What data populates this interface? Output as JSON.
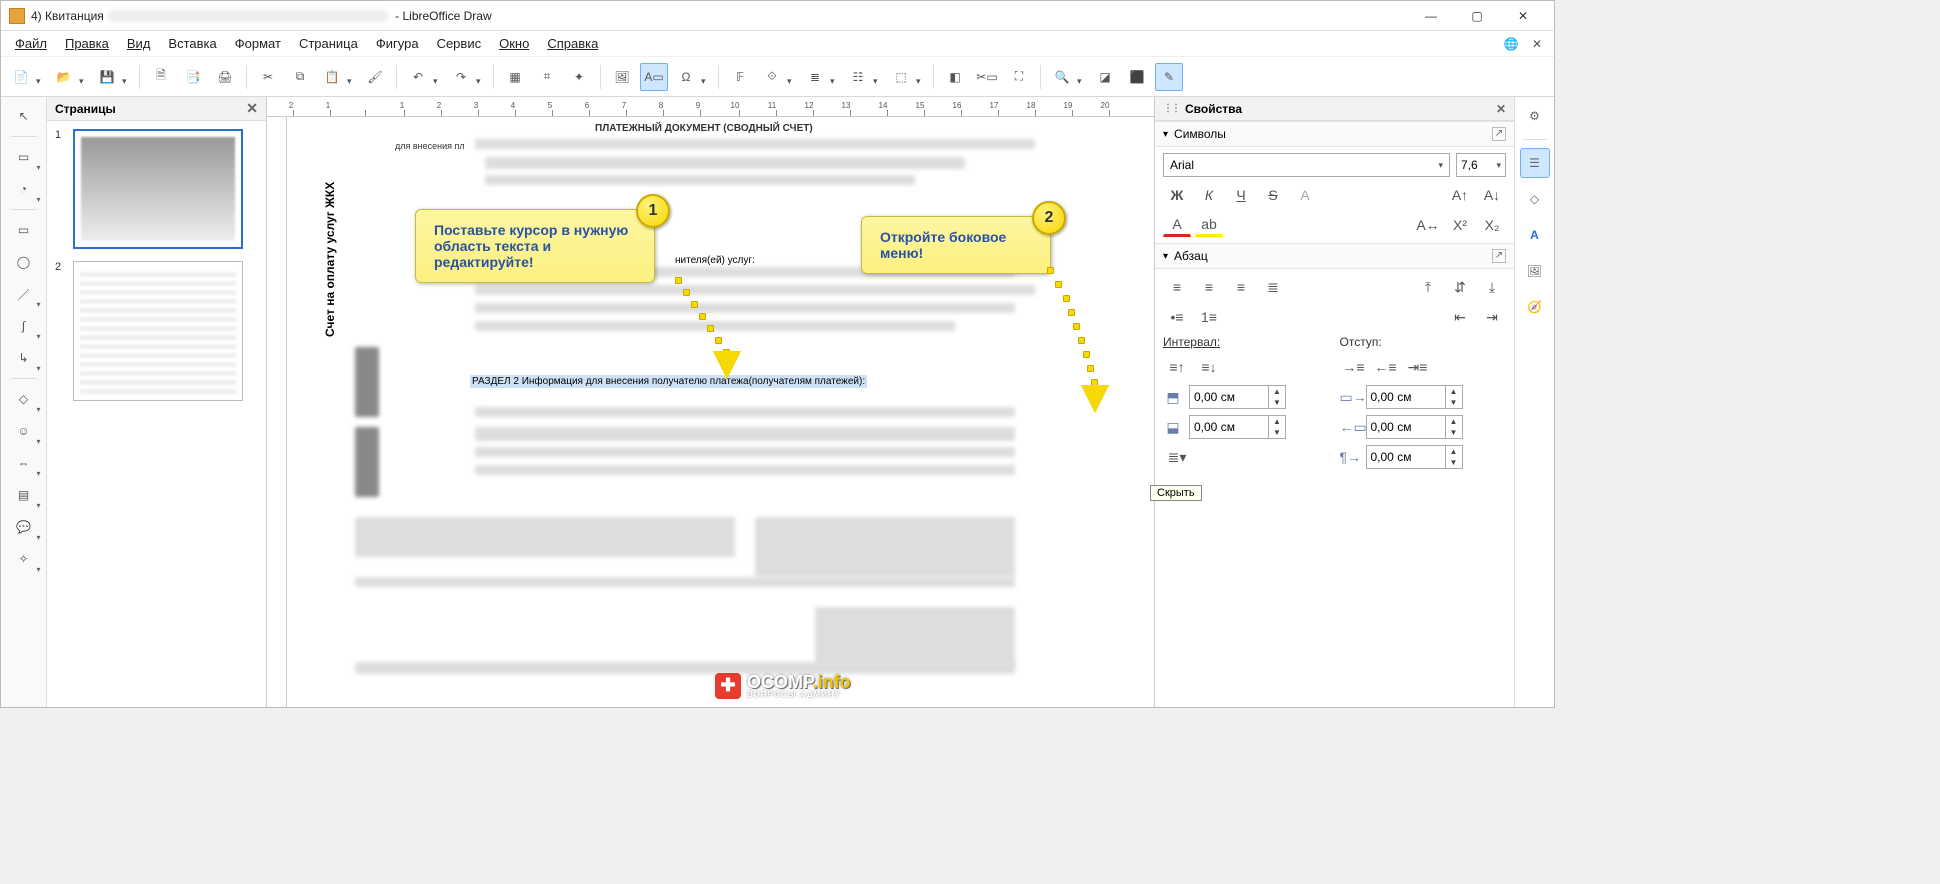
{
  "titlebar": {
    "doc_prefix": "4) Квитанция",
    "app_name": "LibreOffice Draw"
  },
  "menu": {
    "file": "Файл",
    "edit": "Правка",
    "view": "Вид",
    "insert": "Вставка",
    "format": "Формат",
    "page": "Страница",
    "shape": "Фигура",
    "service": "Сервис",
    "window": "Окно",
    "help": "Справка"
  },
  "pages_panel": {
    "title": "Страницы",
    "page1": "1",
    "page2": "2"
  },
  "canvas": {
    "vertical_label": "Счет на оплату услуг ЖКХ",
    "doc_head": "ПЛАТЕЖНЫЙ ДОКУМЕНТ (СВОДНЫЙ СЧЕТ)",
    "doc_sub": "для внесения пл",
    "exec_label": "нителя(ей) услуг:",
    "selected_text": "РАЗДЕЛ  2 Информация для внесения получателю платежа(получателям платежей):",
    "callout1": "Поставьте курсор в нужную область текста и редактируйте!",
    "badge1": "1",
    "callout2": "Откройте боковое меню!",
    "badge2": "2"
  },
  "sidebar": {
    "props_title": "Свойства",
    "sec_chars": "Символы",
    "sec_para": "Абзац",
    "font_name": "Arial",
    "font_size": "7,6",
    "interval_label": "Интервал:",
    "indent_label": "Отступ:",
    "interval_above": "0,00 см",
    "interval_below": "0,00 см",
    "indent_before": "0,00 см",
    "indent_after": "0,00 см",
    "indent_first": "0,00 см",
    "tooltip": "Скрыть"
  },
  "watermark": {
    "brand": "OCOMP",
    "suffix": ".info",
    "tagline": "ВОПРОСЫ АДМИНУ"
  },
  "ruler_ticks": [
    "2",
    "1",
    "",
    "1",
    "2",
    "3",
    "4",
    "5",
    "6",
    "7",
    "8",
    "9",
    "10",
    "11",
    "12",
    "13",
    "14",
    "15",
    "16",
    "17",
    "18",
    "19",
    "20"
  ]
}
